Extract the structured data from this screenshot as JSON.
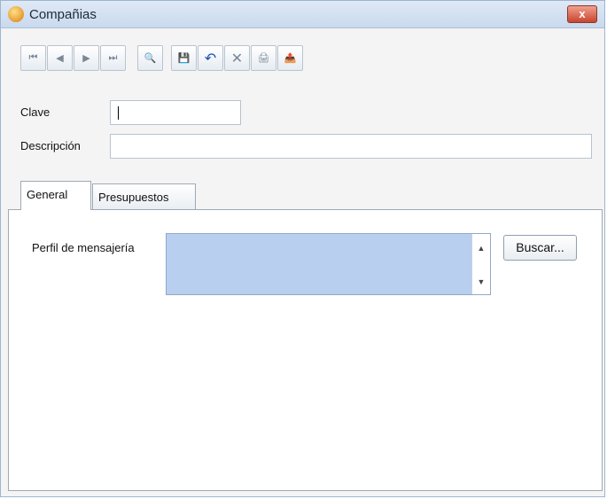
{
  "window": {
    "title": "Compañias",
    "close_label": "x"
  },
  "toolbar": {
    "buttons": [
      {
        "name": "first-record-button",
        "icon": "first-icon",
        "glyph": "⏮"
      },
      {
        "name": "prev-record-button",
        "icon": "prev-icon",
        "glyph": "◀"
      },
      {
        "name": "next-record-button",
        "icon": "next-icon",
        "glyph": "▶"
      },
      {
        "name": "last-record-button",
        "icon": "last-icon",
        "glyph": "⏭"
      },
      {
        "name": "search-button",
        "icon": "binoculars-icon",
        "glyph": "🔍"
      },
      {
        "name": "save-button",
        "icon": "save-icon",
        "glyph": "💾"
      },
      {
        "name": "undo-button",
        "icon": "undo-icon",
        "glyph": "↶"
      },
      {
        "name": "delete-button",
        "icon": "close-icon",
        "glyph": "✕"
      },
      {
        "name": "print-button",
        "icon": "print-icon",
        "glyph": "🖨"
      },
      {
        "name": "export-button",
        "icon": "export-icon",
        "glyph": "📤"
      }
    ]
  },
  "form": {
    "clave_label": "Clave",
    "clave_value": "",
    "descripcion_label": "Descripción",
    "descripcion_value": ""
  },
  "tabs": [
    {
      "label": "General",
      "active": true
    },
    {
      "label": "Presupuestos",
      "active": false
    }
  ],
  "general": {
    "perfil_label": "Perfil de mensajería",
    "buscar_label": "Buscar..."
  },
  "colors": {
    "title_bg": "#c9d9ee",
    "list_bg": "#b8cff0",
    "close_btn": "#c8452e"
  }
}
